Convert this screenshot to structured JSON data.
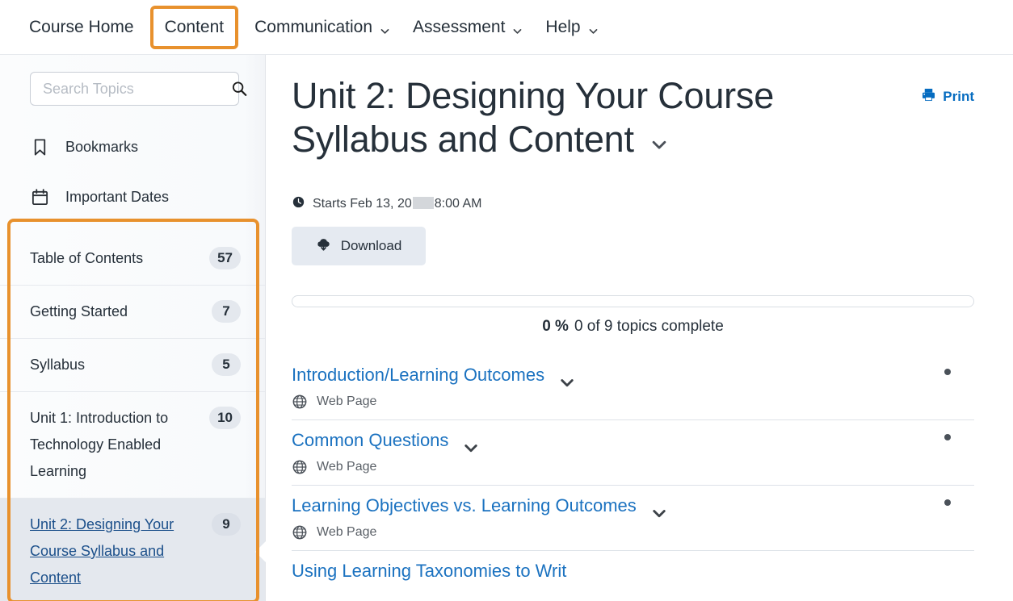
{
  "topnav": {
    "items": [
      {
        "label": "Course Home",
        "has_caret": false,
        "highlighted": false
      },
      {
        "label": "Content",
        "has_caret": false,
        "highlighted": true
      },
      {
        "label": "Communication",
        "has_caret": true,
        "highlighted": false
      },
      {
        "label": "Assessment",
        "has_caret": true,
        "highlighted": false
      },
      {
        "label": "Help",
        "has_caret": true,
        "highlighted": false
      }
    ]
  },
  "sidebar": {
    "search": {
      "value": "",
      "placeholder": "Search Topics",
      "icon": "search-icon"
    },
    "links": [
      {
        "label": "Bookmarks",
        "icon": "bookmark-icon"
      },
      {
        "label": "Important Dates",
        "icon": "calendar-icon"
      }
    ],
    "toc": [
      {
        "label": "Table of Contents",
        "count": "57",
        "selected": false
      },
      {
        "label": "Getting Started",
        "count": "7",
        "selected": false
      },
      {
        "label": "Syllabus",
        "count": "5",
        "selected": false
      },
      {
        "label": "Unit 1: Introduction to Technology Enabled Learning",
        "count": "10",
        "selected": false
      },
      {
        "label": "Unit 2: Designing Your Course Syllabus and Content",
        "count": "9",
        "selected": true
      }
    ]
  },
  "main": {
    "title": "Unit 2: Designing Your Course Syllabus and Content",
    "title_caret_icon": "chevron-down-icon",
    "print": {
      "label": "Print",
      "icon": "printer-icon"
    },
    "starts": {
      "icon": "clock-icon",
      "prefix": "Starts Feb 13, 20",
      "suffix": "8:00 AM"
    },
    "download": {
      "label": "Download",
      "icon": "cloud-download-icon"
    },
    "progress": {
      "percent_value": 0,
      "percent_label": "0 %",
      "fraction_label": "0 of 9 topics complete"
    },
    "topics": [
      {
        "title": "Introduction/Learning Outcomes",
        "type": "Web Page",
        "type_icon": "globe-icon",
        "caret_icon": "chevron-down-icon",
        "dot_icon": "more-options-dot-icon"
      },
      {
        "title": "Common Questions",
        "type": "Web Page",
        "type_icon": "globe-icon",
        "caret_icon": "chevron-down-icon",
        "dot_icon": "more-options-dot-icon"
      },
      {
        "title": "Learning Objectives vs. Learning Outcomes",
        "type": "Web Page",
        "type_icon": "globe-icon",
        "caret_icon": "chevron-down-icon",
        "dot_icon": "more-options-dot-icon"
      },
      {
        "title": "Using Learning Taxonomies to Writ",
        "type": "",
        "type_icon": "globe-icon",
        "caret_icon": "chevron-down-icon",
        "dot_icon": "more-options-dot-icon"
      }
    ]
  },
  "colors": {
    "highlight_orange": "#e8912d",
    "link_blue": "#1b72c0",
    "print_blue": "#066cc0",
    "selected_row_bg": "#e4e8ee",
    "text_dark": "#26303a"
  }
}
